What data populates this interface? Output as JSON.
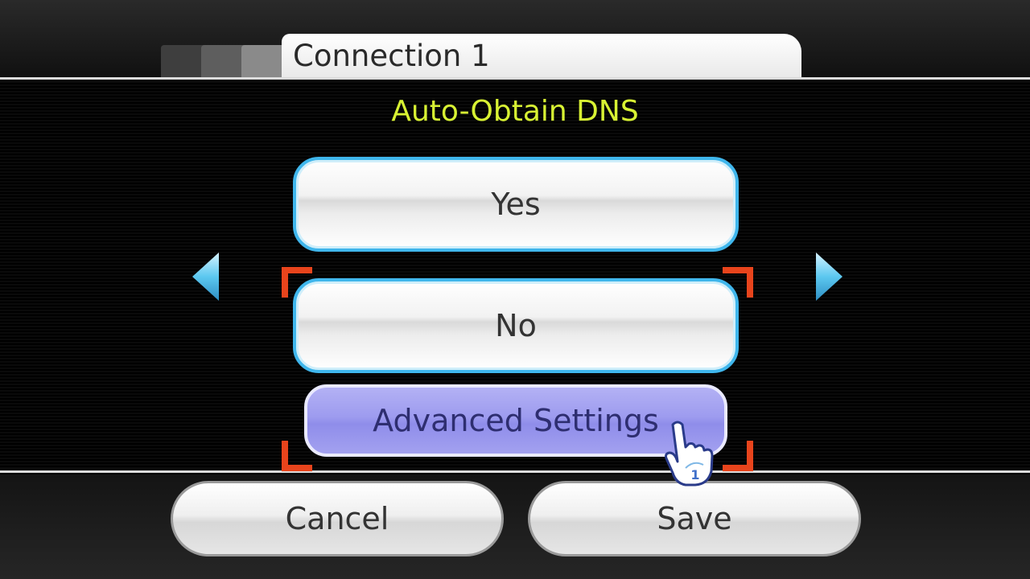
{
  "header": {
    "title": "Connection 1"
  },
  "main": {
    "heading": "Auto-Obtain DNS",
    "options": [
      {
        "label": "Yes"
      },
      {
        "label": "No"
      }
    ],
    "advanced_label": "Advanced Settings"
  },
  "footer": {
    "cancel_label": "Cancel",
    "save_label": "Save"
  },
  "icons": {
    "left_arrow": "triangle-left-icon",
    "right_arrow": "triangle-right-icon",
    "pointer": "hand-pointer-icon"
  },
  "pointer": {
    "player_number": "1"
  },
  "colors": {
    "heading": "#d8f233",
    "option_border": "#3fb6ec",
    "advanced_fill": "#9d9bef",
    "selection_bracket": "#e8441c",
    "arrow": "#5cc8f0"
  }
}
